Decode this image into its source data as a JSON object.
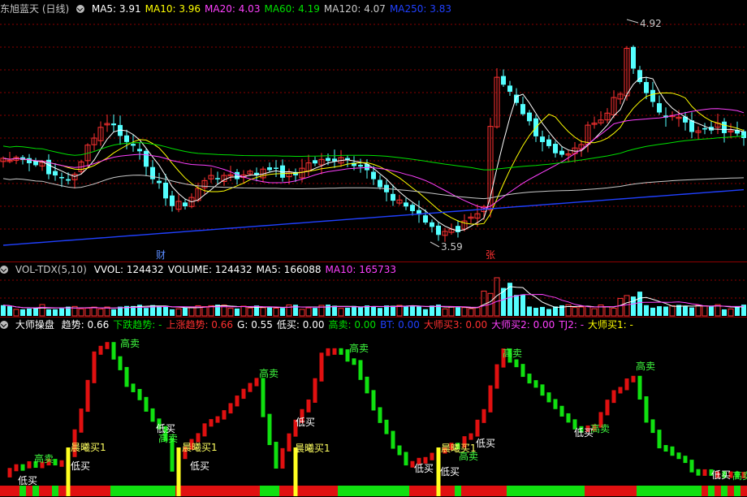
{
  "main": {
    "title": "东旭蓝天 (日线)",
    "ma": [
      {
        "label": "MA5: 3.91",
        "color": "#ffffff"
      },
      {
        "label": "MA10: 3.96",
        "color": "#ffff00"
      },
      {
        "label": "MA20: 4.03",
        "color": "#ff40ff"
      },
      {
        "label": "MA60: 4.19",
        "color": "#00e000"
      },
      {
        "label": "MA120: 4.07",
        "color": "#c8c8c8"
      },
      {
        "label": "MA250: 3.83",
        "color": "#2040ff"
      }
    ],
    "high_label": "4.92",
    "low_label": "3.59",
    "marker_cai": "财",
    "marker_zhang": "张"
  },
  "vol": {
    "title": "VOL-TDX(5,10)",
    "items": [
      {
        "label": "VVOL: 124432",
        "color": "#ffffff"
      },
      {
        "label": "VOLUME: 124432",
        "color": "#ffffff"
      },
      {
        "label": "MA5: 166088",
        "color": "#ffffff"
      },
      {
        "label": "MA10: 165733",
        "color": "#ff40ff"
      }
    ]
  },
  "ind": {
    "title": "大师操盘",
    "items": [
      {
        "label": "趋势: 0.66",
        "color": "#ffffff"
      },
      {
        "label": "下跌趋势: -",
        "color": "#00e000"
      },
      {
        "label": "上涨趋势: 0.66",
        "color": "#ff3030"
      },
      {
        "label": "G: 0.55",
        "color": "#ffffff"
      },
      {
        "label": "低买: 0.00",
        "color": "#ffffff"
      },
      {
        "label": "高卖: 0.00",
        "color": "#00e000"
      },
      {
        "label": "BT: 0.00",
        "color": "#2040ff"
      },
      {
        "label": "大师买3: 0.00",
        "color": "#ff3030"
      },
      {
        "label": "大师买2: 0.00",
        "color": "#ff40ff"
      },
      {
        "label": "TJ2: -",
        "color": "#ff40ff"
      },
      {
        "label": "大师买1: -",
        "color": "#ffff00"
      }
    ],
    "annotations": {
      "sell": "高卖",
      "buy": "低买",
      "dawn_buy": "晨曦买1"
    }
  },
  "colors": {
    "up": "#ff3232",
    "down": "#54ffff",
    "grid": "#8c0000",
    "ind_up": "#e01010",
    "ind_down": "#10e010",
    "dawn": "#ffff20"
  }
}
